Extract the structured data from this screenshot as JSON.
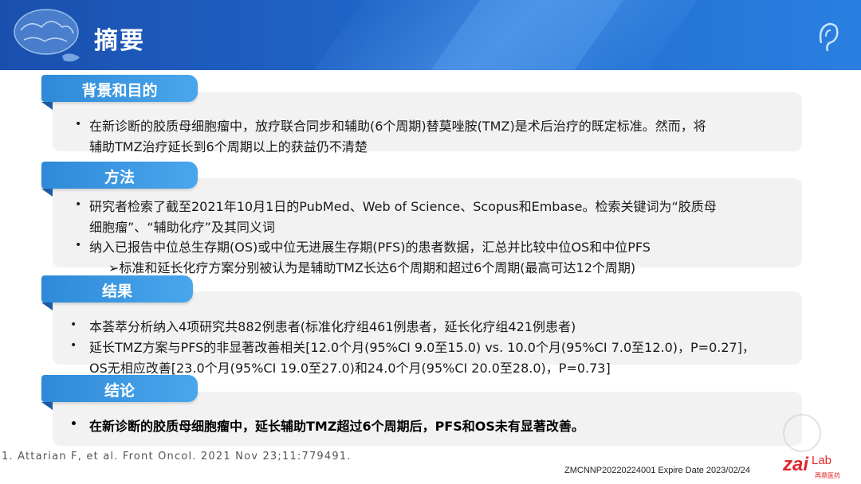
{
  "header": {
    "title": "摘要"
  },
  "sections": {
    "background": {
      "tab": "背景和目的",
      "lines": [
        "在新诊断的胶质母细胞瘤中，放疗联合同步和辅助(6个周期)替莫唑胺(TMZ)是术后治疗的既定标准。然而，将",
        "辅助TMZ治疗延长到6个周期以上的获益仍不清楚"
      ]
    },
    "methods": {
      "tab": "方法",
      "lines": [
        "研究者检索了截至2021年10月1日的PubMed、Web of Science、Scopus和Embase。检索关键词为“胶质母",
        "细胞瘤”、“辅助化疗”及其同义词",
        "纳入已报告中位总生存期(OS)或中位无进展生存期(PFS)的患者数据，汇总并比较中位OS和中位PFS",
        "➢标准和延长化疗方案分别被认为是辅助TMZ长达6个周期和超过6个周期(最高可达12个周期)"
      ]
    },
    "results": {
      "tab": "结果",
      "lines": [
        "本荟萃分析纳入4项研究共882例患者(标准化疗组461例患者，延长化疗组421例患者)",
        "延长TMZ方案与PFS的非显著改善相关[12.0个月(95%CI 9.0至15.0) vs. 10.0个月(95%CI 7.0至12.0)，P=0.27]，",
        "OS无相应改善[23.0个月(95%CI 19.0至27.0)和24.0个月(95%CI 20.0至28.0)，P=0.73]"
      ]
    },
    "conclusion": {
      "tab": "结论",
      "lines": [
        "在新诊断的胶质母细胞瘤中，延长辅助TMZ超过6个周期后，PFS和OS未有显著改善。"
      ]
    }
  },
  "bullet_char": "•",
  "footer": {
    "reference": "1. Attarian F, et al. Front Oncol. 2021 Nov 23;11:779491.",
    "code": "ZMCNNP20220224001 Expire Date 2023/02/24",
    "logo_main": "zai",
    "logo_lab": "Lab",
    "logo_sub": "再鼎医药"
  }
}
